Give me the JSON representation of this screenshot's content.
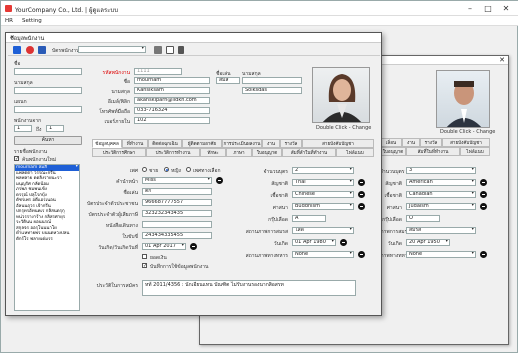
{
  "app": {
    "title": "YourCompany Co., Ltd. | ผู้ดูแลระบบ",
    "menu": [
      "HR",
      "Setting"
    ]
  },
  "dialog": {
    "title": "ข้อมูลพนักงาน",
    "toolbar_label": "บัตรพนักงาน"
  },
  "search": {
    "labels": [
      "ชื่อ",
      "นามสกุล",
      "แผนก",
      "พนักงานจาก",
      "ถึง"
    ],
    "from": "1",
    "to": "1",
    "button": "ค้นหา",
    "section": "รายชื่อพนักงาน",
    "filter": "ค้นพนักงานใหม่"
  },
  "employee_list": [
    "mournam สมสี",
    "แพลตตา วรรณะกรีน",
    "พลพลาย ดดลิงรายนะรา",
    "มนุญรัศ กลัดน้อม",
    "ภรพภ ชมพนเข้ง",
    "ดรรุณ์ ปลุโรกบุ้ง",
    "ดัชรเพร อดีแอรเนอน",
    "อัลนนถุวร เจ้ากรีน",
    "ปกรุทรอัทนคเร กลิสนดรุกุ",
    "หน่วรรางาร้าง กลิสรศายุร",
    "ระวัดินน ยอนนรณ์",
    "สกุลจร ออรุโนนนาโย",
    "ตำเเหทายพร บนนดหวงปลน",
    "ตักร์โร ฟลายเด่มรร"
  ],
  "header": {
    "code_label": "รหัสพนักงาน",
    "code": "1111",
    "name_label": "ชื่อเล่น",
    "nickname_label": "ชื่อเล่น",
    "first_name_label": "ชื่อ",
    "first_name": "mournam",
    "nickname": "สมสี",
    "lastname_label": "นามสกุล",
    "last_name": "Kansiksam",
    "last_name_en": "Soiksdas",
    "email_label": "อีเมล์/พิลิก",
    "email": "akanskiparn@lidkh.com",
    "phone_label": "โทรศัพท์มือถือ",
    "phone": "033-716324",
    "ext_label": "เบอร์ภายใน",
    "ext": "102",
    "photo_caption": "Double Click - Change"
  },
  "tabs_row1": [
    "ข้อมูลบุคคล",
    "ที่ทำงาน",
    "ติดต่อฉุกเฉิน",
    "ผู้ติดตามอาศัย",
    "การประเมินผลงาน",
    "งาน",
    "รางวัล",
    "สายบังคับบัญชา"
  ],
  "tabs_row2": [
    "ประวัติการศึกษา",
    "ประวัติการทำงาน",
    "ทักษะ",
    "ภาษา",
    "ใบอนุญาต",
    "สัมทิ์ลำในที่ทำงาน",
    "ไฟล์แนบ"
  ],
  "tabs_row2_first": "ประวัติการศึกษา",
  "personal": {
    "gender_label": "เพศ",
    "genders": [
      "ชาย",
      "หญิง",
      "เพศทางเลือก"
    ],
    "title_label": "คำนำหน้า",
    "title": "Miss",
    "nickname_label": "ชื่อเล่น",
    "nickname": "ตัก",
    "idcard_label": "บัตรประจำตัวประชาชน",
    "idcard": "966687777557",
    "taxid_label": "บัตรประจำตัวผู้เสียภาษี",
    "taxid": "323232343435",
    "passport_label": "หนังสือเดินทาง",
    "passport": "",
    "license_label": "ใบขับขี่",
    "license": "243434335455",
    "birth_label": "วันเกิด/วันเกิดวันที่",
    "birth": "01 Apr 2017",
    "check_label": "ยอดเงิน",
    "check2_label": "บันทึกการใช้ข้อมูลพนักงาน",
    "note_label": "ประวัติในการสมัคร",
    "note": "หท้ 2011/4356 : นักเอียนแทน บัณฑิต ไม่รับงานรองนากสิอสรท"
  },
  "right": {
    "children_label": "จำนวนบุตร",
    "children": "2",
    "nationality_label": "สัญชาติ",
    "nationality": "Thai",
    "race_label": "เชื้อชาติ",
    "race": "Chinese",
    "religion_label": "ศาสนา",
    "religion": "Buddhism",
    "blood_label": "กรุ๊ปเลือด",
    "blood": "A",
    "marital_label": "สถานภาพการสมรส",
    "marital": "โสด",
    "since_label": "วันเกิด",
    "since": "01 Apr 1980",
    "military_label": "สถานภาพทางทหาร",
    "military": "None"
  },
  "bg": {
    "photo_caption": "Double Click - Change",
    "tabs": [
      "เลิ่อน",
      "งาน",
      "รางวัล",
      "สายบังคับบัญชา",
      "ใบอนุญาต",
      "สัมทิ์ในที่ทำงาน",
      "ไฟล์แนบ"
    ],
    "children": "3",
    "nationality": "American",
    "race": "Canadian",
    "religion": "Judaism",
    "blood": "O",
    "marital": "สมรส",
    "since": "20 Apr 1950",
    "military": "None",
    "labels": [
      "จำนวนบุตร",
      "สัญชาติ",
      "เชื้อชาติ",
      "ศาสนา",
      "กรุ๊ปเลือด",
      "สถานภาพการสมรส",
      "วันเกิด",
      "สถานภาพทางทหาร"
    ]
  },
  "colors": {
    "accent": "#1e5fd6",
    "required": "#d00000"
  }
}
